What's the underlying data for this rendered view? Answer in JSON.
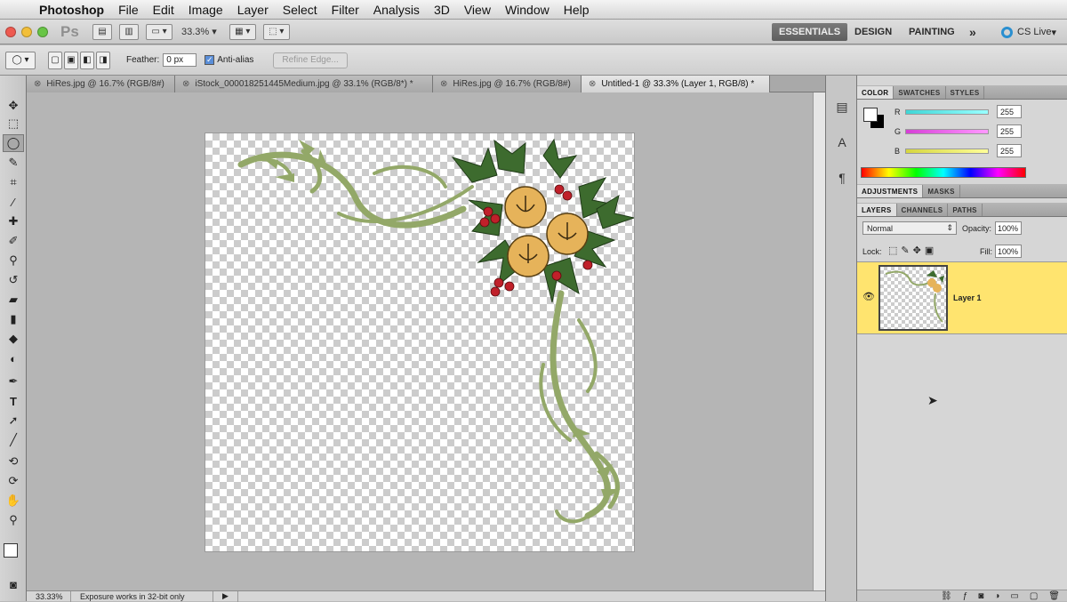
{
  "menubar": {
    "app": "Photoshop",
    "items": [
      "File",
      "Edit",
      "Image",
      "Layer",
      "Select",
      "Filter",
      "Analysis",
      "3D",
      "View",
      "Window",
      "Help"
    ]
  },
  "appbar": {
    "logo": "Ps",
    "zoom": "33.3%",
    "workspaces": [
      "ESSENTIALS",
      "DESIGN",
      "PAINTING"
    ],
    "more": "»",
    "cs_live": "CS Live"
  },
  "options": {
    "feather_label": "Feather:",
    "feather_value": "0 px",
    "antialias_label": "Anti-alias",
    "antialias_checked": true,
    "refine_label": "Refine Edge..."
  },
  "tabs": [
    {
      "label": "HiRes.jpg @ 16.7% (RGB/8#)",
      "active": false
    },
    {
      "label": "iStock_000018251445Medium.jpg @ 33.1% (RGB/8*) *",
      "active": false
    },
    {
      "label": "HiRes.jpg @ 16.7% (RGB/8#)",
      "active": false
    },
    {
      "label": "Untitled-1 @ 33.3% (Layer 1, RGB/8) *",
      "active": true
    }
  ],
  "status": {
    "zoom": "33.33%",
    "message": "Exposure works in 32-bit only"
  },
  "color_panel": {
    "tabs": [
      "COLOR",
      "SWATCHES",
      "STYLES"
    ],
    "channels": [
      {
        "label": "R",
        "value": "255",
        "color": "#3fd6d6"
      },
      {
        "label": "G",
        "value": "255",
        "color": "#d63fd6"
      },
      {
        "label": "B",
        "value": "255",
        "color": "#d6d63f"
      }
    ]
  },
  "adjust_panel": {
    "tabs": [
      "ADJUSTMENTS",
      "MASKS"
    ]
  },
  "layers_panel": {
    "tabs": [
      "LAYERS",
      "CHANNELS",
      "PATHS"
    ],
    "blend_mode": "Normal",
    "opacity_label": "Opacity:",
    "opacity_value": "100%",
    "lock_label": "Lock:",
    "fill_label": "Fill:",
    "fill_value": "100%",
    "layer_name": "Layer 1"
  },
  "colors": {
    "selection": "#ffe46f",
    "holly": "#3d6b2e",
    "berry": "#c0202a",
    "bell": "#e6b35a",
    "swirl": "#93a868"
  }
}
